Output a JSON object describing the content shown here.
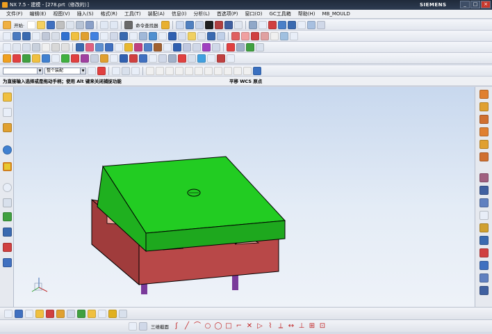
{
  "window": {
    "title": "NX 7.5 - 建模 - [278.prt（修改的）]",
    "brand": "SIEMENS",
    "controls": [
      "minimize",
      "restore",
      "close"
    ]
  },
  "menubar": {
    "items": [
      "文件(F)",
      "编辑(E)",
      "视图(V)",
      "插入(S)",
      "格式(R)",
      "工具(T)",
      "装配(A)",
      "信息(I)",
      "分析(L)",
      "首选项(P)",
      "窗口(O)",
      "GC工具箱",
      "帮助(H)",
      "MB_MOULD"
    ]
  },
  "toolbar": {
    "start_label": "开始·",
    "command_finder_label": "命令查找器"
  },
  "selection_bar": {
    "filter_value": "",
    "scope_value": "整个装配"
  },
  "cue_line": {
    "prompt": "为直接输入选择或是拖动手柄；使用 Alt 键来关闭捕捉功能",
    "status": "平移 WCS 原点"
  },
  "colors": {
    "top_plate": "#22cc22",
    "bottom_plate": "#b84848",
    "pocket": "#f0a8a0",
    "pins": "#7a3a9a",
    "viewport_top": "#c8d8ee",
    "viewport_bottom": "#eef2f8"
  },
  "viewport": {
    "model_description_icons": [
      "wcs-triad-icon"
    ]
  },
  "bottom_toolbar": {
    "sketch_label": "三维截面"
  }
}
